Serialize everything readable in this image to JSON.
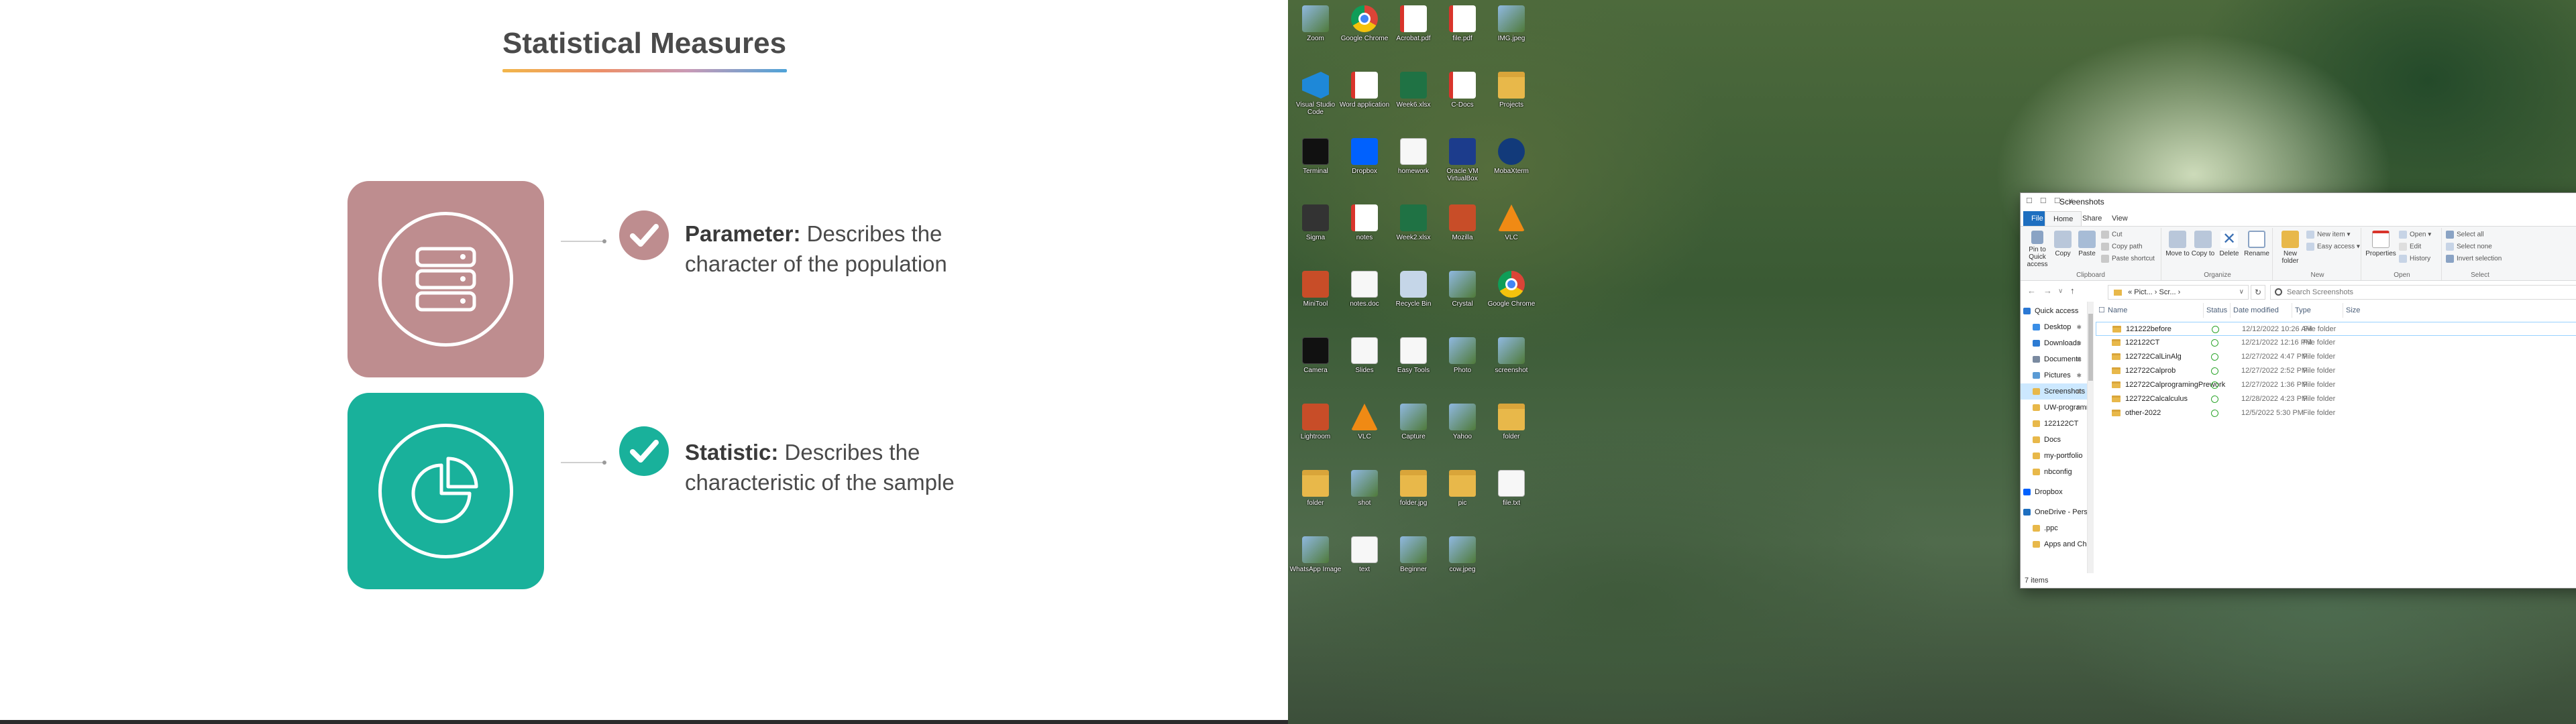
{
  "slide": {
    "title": "Statistical Measures",
    "items": [
      {
        "term": "Parameter:",
        "description_line1": "Describes the",
        "description_line2": "character of the population",
        "icon": "database-icon",
        "color": "#be8d8f"
      },
      {
        "term": "Statistic:",
        "description_line1": "Describes the",
        "description_line2": "characteristic of the sample",
        "icon": "pie-chart-icon",
        "color": "#19b19b"
      }
    ]
  },
  "desktop": {
    "icons": [
      {
        "label": "Zoom",
        "kind": "img-file"
      },
      {
        "label": "Google Chrome",
        "kind": "chrome"
      },
      {
        "label": "Acrobat.pdf",
        "kind": "pdf"
      },
      {
        "label": "file.pdf",
        "kind": "pdf"
      },
      {
        "label": "IMG.jpeg",
        "kind": "img-file"
      },
      {
        "label": "Visual Studio Code",
        "kind": "vscode"
      },
      {
        "label": "Word application",
        "kind": "pdf"
      },
      {
        "label": "Week6.xlsx",
        "kind": "excel"
      },
      {
        "label": "C-Docs",
        "kind": "pdf"
      },
      {
        "label": "Projects",
        "kind": "folder"
      },
      {
        "label": "Terminal",
        "kind": "term"
      },
      {
        "label": "Dropbox",
        "kind": "dropbox"
      },
      {
        "label": "homework",
        "kind": "doc"
      },
      {
        "label": "Oracle VM VirtualBox",
        "kind": "vbox"
      },
      {
        "label": "MobaXterm",
        "kind": "mbox"
      },
      {
        "label": "Sigma",
        "kind": "sigma"
      },
      {
        "label": "notes",
        "kind": "pdf"
      },
      {
        "label": "Week2.xlsx",
        "kind": "excel"
      },
      {
        "label": "Mozilla",
        "kind": "app"
      },
      {
        "label": "VLC",
        "kind": "vlc"
      },
      {
        "label": "MiniTool",
        "kind": "app"
      },
      {
        "label": "notes.doc",
        "kind": "doc"
      },
      {
        "label": "Recycle Bin",
        "kind": "recycle"
      },
      {
        "label": "Crystal",
        "kind": "img-file"
      },
      {
        "label": "Google Chrome",
        "kind": "chrome"
      },
      {
        "label": "Camera",
        "kind": "term"
      },
      {
        "label": "Slides",
        "kind": "doc"
      },
      {
        "label": "Easy Tools",
        "kind": "doc"
      },
      {
        "label": "Photo",
        "kind": "img-file"
      },
      {
        "label": "screenshot",
        "kind": "img-file"
      },
      {
        "label": "Lightroom",
        "kind": "app"
      },
      {
        "label": "VLC",
        "kind": "vlc"
      },
      {
        "label": "Capture",
        "kind": "img-file"
      },
      {
        "label": "Yahoo",
        "kind": "img-file"
      },
      {
        "label": "folder",
        "kind": "folder"
      },
      {
        "label": "folder",
        "kind": "folder"
      },
      {
        "label": "shot",
        "kind": "img-file"
      },
      {
        "label": "folder.jpg",
        "kind": "folder"
      },
      {
        "label": "pic",
        "kind": "folder"
      },
      {
        "label": "file.txt",
        "kind": "doc"
      },
      {
        "label": "WhatsApp Image",
        "kind": "img-file"
      },
      {
        "label": "text",
        "kind": "doc"
      },
      {
        "label": "Beginner",
        "kind": "img-file"
      },
      {
        "label": "cow.jpeg",
        "kind": "img-file"
      }
    ]
  },
  "explorer": {
    "title": "Screenshots",
    "quick_access": "☐ ☐ ☐ ∨",
    "window_buttons": {
      "minimize": "—",
      "maximize": "☐",
      "close": "✕"
    },
    "tabs": [
      "File",
      "Home",
      "Share",
      "View"
    ],
    "ribbon": {
      "clipboard": {
        "label": "Clipboard",
        "pin": "Pin to Quick access",
        "copy": "Copy",
        "paste": "Paste",
        "cut": "Cut",
        "copy_path": "Copy path",
        "paste_shortcut": "Paste shortcut"
      },
      "organize": {
        "label": "Organize",
        "move_to": "Move to",
        "copy_to": "Copy to",
        "delete": "Delete",
        "rename": "Rename"
      },
      "new": {
        "label": "New",
        "new_folder": "New folder",
        "new_item": "New item",
        "easy_access": "Easy access"
      },
      "open": {
        "label": "Open",
        "properties": "Properties",
        "open": "Open",
        "edit": "Edit",
        "history": "History"
      },
      "select": {
        "label": "Select",
        "select_all": "Select all",
        "select_none": "Select none",
        "invert": "Invert selection"
      }
    },
    "address": {
      "path": "« Pict... › Scr... ›",
      "search_placeholder": "Search Screenshots"
    },
    "nav_buttons": {
      "back": "←",
      "forward": "→",
      "recent": "∨",
      "up": "↑",
      "refresh": "↻",
      "dropdown": "∨"
    },
    "nav_pane": [
      {
        "label": "Quick access",
        "kind": "star"
      },
      {
        "label": "Desktop",
        "kind": "desk",
        "pinned": true
      },
      {
        "label": "Downloads",
        "kind": "down",
        "pinned": true
      },
      {
        "label": "Documents",
        "kind": "docs",
        "pinned": true
      },
      {
        "label": "Pictures",
        "kind": "pics",
        "pinned": true
      },
      {
        "label": "Screenshots",
        "kind": "folder",
        "pinned": true,
        "selected": true
      },
      {
        "label": "UW-programming BC",
        "kind": "folder",
        "pinned": true
      },
      {
        "label": "122122CT",
        "kind": "folder"
      },
      {
        "label": "Docs",
        "kind": "folder"
      },
      {
        "label": "my-portfolio",
        "kind": "folder"
      },
      {
        "label": "nbconfig",
        "kind": "folder"
      },
      {
        "label": "Dropbox",
        "kind": "dropbox"
      },
      {
        "label": "OneDrive - Personal",
        "kind": "cloud"
      },
      {
        "label": ".ppc",
        "kind": "folder"
      },
      {
        "label": "Apps and Chat",
        "kind": "folder"
      }
    ],
    "columns": [
      "Name",
      "Status",
      "Date modified",
      "Type",
      "Size"
    ],
    "files": [
      {
        "name": "121222before",
        "date": "12/12/2022 10:26 AM",
        "type": "File folder",
        "selected": true
      },
      {
        "name": "122122CT",
        "date": "12/21/2022 12:16 PM",
        "type": "File folder"
      },
      {
        "name": "122722CalLinAlg",
        "date": "12/27/2022 4:47 PM",
        "type": "File folder"
      },
      {
        "name": "122722Calprob",
        "date": "12/27/2022 2:52 PM",
        "type": "File folder"
      },
      {
        "name": "122722CalprogramingPrework",
        "date": "12/27/2022 1:36 PM",
        "type": "File folder"
      },
      {
        "name": "122722Calcalculus",
        "date": "12/28/2022 4:23 PM",
        "type": "File folder"
      },
      {
        "name": "other-2022",
        "date": "12/5/2022 5:30 PM",
        "type": "File folder"
      }
    ],
    "status": "7 items"
  },
  "colors": {
    "accent_blue": "#1e6fc0",
    "card_rose": "#be8d8f",
    "card_teal": "#19b19b"
  }
}
